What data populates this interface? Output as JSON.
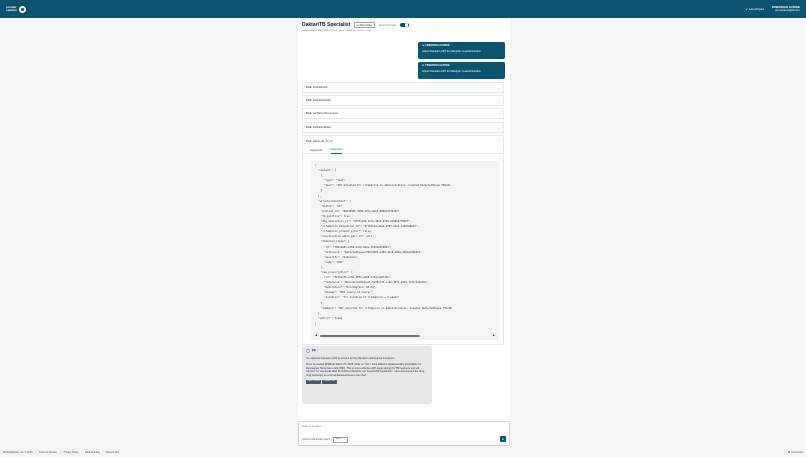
{
  "header": {
    "logo_line1": "prompt",
    "logo_line2": "opinion",
    "launchpad": "Launchpad",
    "user_name": "FRIEDRICH GORKE",
    "user_subtitle": "pet entrance@home.t"
  },
  "agent": {
    "title": "DaktariTB Specialist",
    "web_button": "Web Finder",
    "show_tool_calls": "Show Tool Calls",
    "subtitle": "Patient/Session BRIBI NBA 2021-14 · client 1 (ADMIN) · Schlaf 5: 1010"
  },
  "friend_cards": [
    {
      "name": "FRIEDRICH GORKE",
      "text": "Adjust Damask's ART for rifampicin co-administration."
    },
    {
      "name": "FRIEDRICH GORKE",
      "text": "Adjust Damask's ART for rifampicin co-administration."
    }
  ],
  "tools": [
    {
      "prefix": "Tool:",
      "name": "findPatientId"
    },
    {
      "prefix": "Tool:",
      "name": "GetPatientData"
    },
    {
      "prefix": "Tool:",
      "name": "GetPatientDocuments"
    },
    {
      "prefix": "Tool:",
      "name": "GetPatientData"
    }
  ],
  "open_tool": {
    "prefix": "Tool:",
    "name": "adjust_art_for_rif",
    "tab_arguments": "Arguments",
    "tab_response": "Response",
    "code": "{\n  \"content\": [\n    {\n      \"type\": \"text\",\n      \"text\": \"ART adjusted for rifampicin co-administration. Created DetectedIssue 786c0b\n    }\n  ],\n  \"structuredContent\": {\n    \"status\": \"ok\",\n    \"patient_id\": \"89d3d505-d306-407e-9e65-898013f3bd63\",\n    \"tb_positive\": true,\n    \"dtg_medication_id\": \"937d3a99-1e7e-48c4-af96-9b58bb7f893f\",\n    \"rifampicin_medication_id\": \"8f3b3b12-0be4-4357-9be3-4dd0dd8a9f\",\n    \"rifampicin_present_prior\": false,\n    \"coordination_admin_pair_id\": null,\n    \"detected_issue\": {\n      \"id\": \"786c0b81-e369-44c6-a92a-3b52e245b8b1\",\n      \"reference\": \"DetectedIssue/786c0b81-e369-44c6-a92a-3b52e245b8b1\",\n      \"severity\": \"moderate\",\n      \"code\": \"DRG\"\n    },\n    \"new_prescription\": {\n      \"id\": \"5b70e735-cc8e-4873-a993-1741c1e6730a\",\n      \"reference\": \"MedicationRequest/5b70e735-cc8e-4873-a993-1741c1e6730a\",\n      \"medication\": \"Dolutegravir 50 mg\",\n      \"dosage\": \"BID (every 12 hours)\",\n      \"duration\": \"for duration of rifampicin + 2 weeks\"\n    },\n    \"summary\": \"ART adjusted for rifampicin co-administration. Created DetectedIssue 786c0b\n  },\n  \"isError\": false\n}"
  },
  "pe_message": {
    "sender": "PE",
    "para1": "I've adjusted Damask's ART to account for the rifampicin-dolutegravir interaction.",
    "para2": "Since he started RHZE on March 27, 2025, while on TLD, I have added a supplementary prescription for Dolutegravir 50mg twice daily (BID). This ensures effective ART levels during his TB treatment and will continue for two weeks after he finishes rifampicin, per Kenya MOH guidelines. I also documented the drug-drug interaction as a formal DetectedIssue in the chart.",
    "token_input": "Input: 32985",
    "token_output": "Output: 560"
  },
  "input": {
    "placeholder": "Enter a prompt...",
    "agent_label": "Connect with another agent:",
    "agent_value": "None"
  },
  "footer": {
    "copyright": "PromptOpinion, Inc. © 2025",
    "links": [
      "Terms of Service",
      "Privacy Policy",
      "Data Deletion",
      "Docs & Tips"
    ],
    "status": "Connected"
  }
}
